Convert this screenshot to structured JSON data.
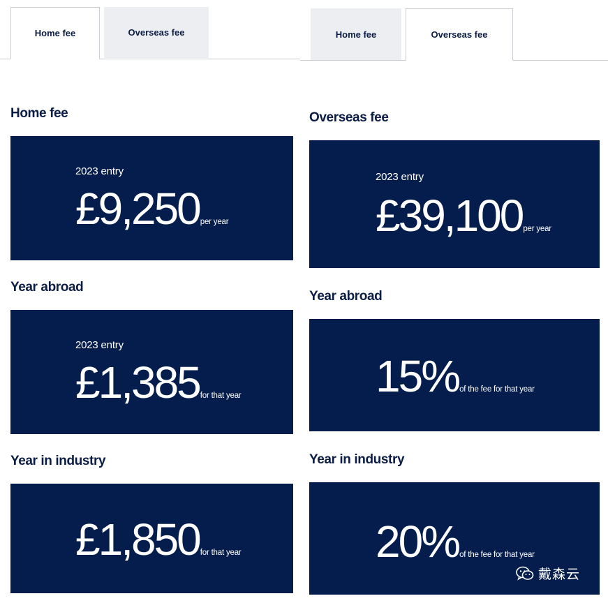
{
  "left": {
    "tabs": [
      {
        "label": "Home fee",
        "active": true
      },
      {
        "label": "Overseas fee",
        "active": false
      }
    ],
    "sections": [
      {
        "title": "Home fee",
        "entry": "2023 entry",
        "amount": "£9,250",
        "suffix": "per year"
      },
      {
        "title": "Year abroad",
        "entry": "2023 entry",
        "amount": "£1,385",
        "suffix": "for that year"
      },
      {
        "title": "Year in industry",
        "entry": "",
        "amount": "£1,850",
        "suffix": "for that year"
      }
    ]
  },
  "right": {
    "tabs": [
      {
        "label": "Home fee",
        "active": false
      },
      {
        "label": "Overseas fee",
        "active": true
      }
    ],
    "sections": [
      {
        "title": "Overseas fee",
        "entry": "2023 entry",
        "amount": "£39,100",
        "suffix": "per year"
      },
      {
        "title": "Year abroad",
        "entry": "",
        "amount": "15%",
        "suffix": "of the fee for that year"
      },
      {
        "title": "Year in industry",
        "entry": "",
        "amount": "20%",
        "suffix": "of the fee for that year"
      }
    ]
  },
  "watermark": {
    "icon": "wechat-icon",
    "text": "戴森云"
  },
  "colors": {
    "navy": "#041d4c",
    "heading": "#0c1d45",
    "tab_inactive_bg": "#eceef1"
  }
}
